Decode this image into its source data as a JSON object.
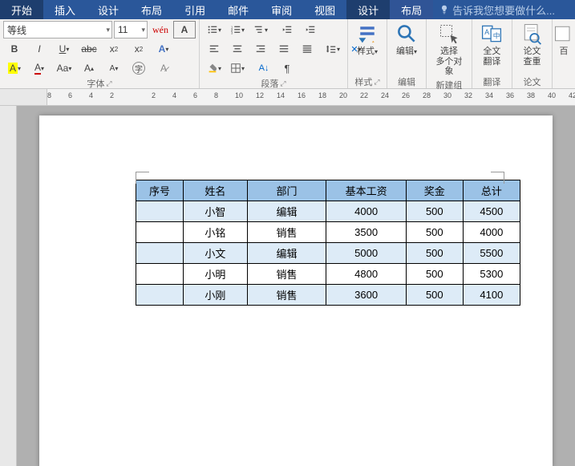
{
  "tabs": {
    "items": [
      "开始",
      "插入",
      "设计",
      "布局",
      "引用",
      "邮件",
      "审阅",
      "视图"
    ],
    "context": [
      "设计",
      "布局"
    ],
    "tell_me": "告诉我您想要做什么..."
  },
  "ribbon": {
    "font": {
      "name": "等线",
      "size": "11",
      "group_label": "字体"
    },
    "paragraph": {
      "group_label": "段落"
    },
    "styles": {
      "group_label": "样式",
      "button": "样式"
    },
    "editing": {
      "group_label": "编辑",
      "button": "编辑"
    },
    "select": {
      "group_label": "新建组",
      "line1": "选择",
      "line2": "多个对象"
    },
    "translate": {
      "group_label": "翻译",
      "line1": "全文",
      "line2": "翻译"
    },
    "dupcheck": {
      "group_label": "论文",
      "line1": "论文",
      "line2": "查重"
    },
    "baidu": {
      "line1": "百"
    }
  },
  "ruler": [
    "8",
    "6",
    "4",
    "2",
    "",
    "2",
    "4",
    "6",
    "8",
    "10",
    "12",
    "14",
    "16",
    "18",
    "20",
    "22",
    "24",
    "26",
    "28",
    "30",
    "32",
    "34",
    "36",
    "38",
    "40",
    "42"
  ],
  "table": {
    "headers": [
      "序号",
      "姓名",
      "部门",
      "基本工资",
      "奖金",
      "总计"
    ],
    "rows": [
      {
        "seq": "",
        "name": "小智",
        "dept": "编辑",
        "base": "4000",
        "bonus": "500",
        "total": "4500",
        "alt": true
      },
      {
        "seq": "",
        "name": "小铭",
        "dept": "销售",
        "base": "3500",
        "bonus": "500",
        "total": "4000",
        "alt": false
      },
      {
        "seq": "",
        "name": "小文",
        "dept": "编辑",
        "base": "5000",
        "bonus": "500",
        "total": "5500",
        "alt": true
      },
      {
        "seq": "",
        "name": "小明",
        "dept": "销售",
        "base": "4800",
        "bonus": "500",
        "total": "5300",
        "alt": false
      },
      {
        "seq": "",
        "name": "小刚",
        "dept": "销售",
        "base": "3600",
        "bonus": "500",
        "total": "4100",
        "alt": true
      }
    ]
  }
}
